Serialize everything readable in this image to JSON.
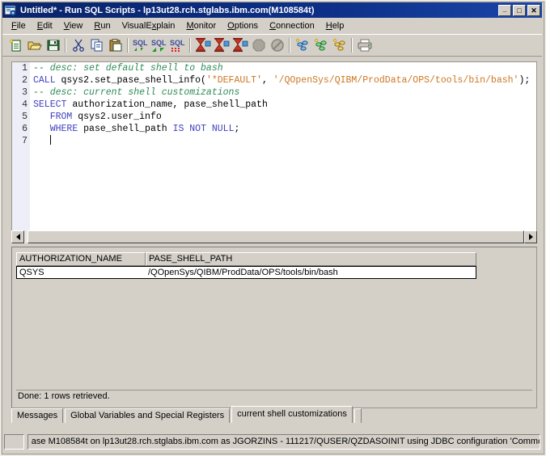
{
  "window": {
    "title": "Untitled* - Run SQL Scripts - lp13ut28.rch.stglabs.ibm.com(M108584t)",
    "app_icon": "sql-scripts-icon",
    "minimize_glyph": "_",
    "maximize_glyph": "□",
    "close_glyph": "✕",
    "titlebar_color": "#0a246a",
    "face_color": "#d4d0c8"
  },
  "menu": {
    "items": [
      {
        "label": "File",
        "mnemonic": "F"
      },
      {
        "label": "Edit",
        "mnemonic": "E"
      },
      {
        "label": "View",
        "mnemonic": "V"
      },
      {
        "label": "Run",
        "mnemonic": "R"
      },
      {
        "label": "VisualExplain",
        "mnemonic": "x"
      },
      {
        "label": "Monitor",
        "mnemonic": "M"
      },
      {
        "label": "Options",
        "mnemonic": "O"
      },
      {
        "label": "Connection",
        "mnemonic": "C"
      },
      {
        "label": "Help",
        "mnemonic": "H"
      }
    ]
  },
  "toolbar": {
    "buttons": [
      {
        "name": "new-icon",
        "tooltip": "New"
      },
      {
        "name": "open-icon",
        "tooltip": "Open"
      },
      {
        "name": "save-icon",
        "tooltip": "Save"
      },
      {
        "name": "separator",
        "tooltip": ""
      },
      {
        "name": "cut-icon",
        "tooltip": "Cut"
      },
      {
        "name": "copy-icon",
        "tooltip": "Copy"
      },
      {
        "name": "paste-icon",
        "tooltip": "Paste"
      },
      {
        "name": "separator",
        "tooltip": ""
      },
      {
        "name": "run-selected-sql-icon",
        "tooltip": "Run Selected"
      },
      {
        "name": "run-from-selected-sql-icon",
        "tooltip": "Run From Selected"
      },
      {
        "name": "run-all-sql-icon",
        "tooltip": "Run All"
      },
      {
        "name": "separator",
        "tooltip": ""
      },
      {
        "name": "stop-on-error-icon",
        "tooltip": "Stop On Error"
      },
      {
        "name": "run-and-stop-icon",
        "tooltip": "Run and Stop"
      },
      {
        "name": "continue-icon",
        "tooltip": "Continue"
      },
      {
        "name": "stop-icon",
        "tooltip": "Stop"
      },
      {
        "name": "cancel-icon",
        "tooltip": "Cancel Request"
      },
      {
        "name": "separator",
        "tooltip": ""
      },
      {
        "name": "visual-explain-icon",
        "tooltip": "Visual Explain"
      },
      {
        "name": "explain-only-icon",
        "tooltip": "Explain Only"
      },
      {
        "name": "run-and-explain-icon",
        "tooltip": "Run and Explain"
      },
      {
        "name": "separator",
        "tooltip": ""
      },
      {
        "name": "print-icon",
        "tooltip": "Print"
      }
    ]
  },
  "editor": {
    "line_numbers": [
      "1",
      "2",
      "3",
      "4",
      "5",
      "6",
      "7"
    ],
    "lines": [
      {
        "n": "1",
        "tokens": [
          {
            "t": "-- desc: set default shell to bash",
            "k": "comment"
          }
        ]
      },
      {
        "n": "2",
        "tokens": [
          {
            "t": "CALL",
            "k": "kw"
          },
          {
            "t": " qsys2.set_pase_shell_info(",
            "k": "plain"
          },
          {
            "t": "'*DEFAULT'",
            "k": "str"
          },
          {
            "t": ", ",
            "k": "plain"
          },
          {
            "t": "'/QOpenSys/QIBM/ProdData/OPS/tools/bin/bash'",
            "k": "str"
          },
          {
            "t": ");",
            "k": "plain"
          }
        ]
      },
      {
        "n": "3",
        "tokens": [
          {
            "t": "-- desc: current shell customizations",
            "k": "comment"
          }
        ]
      },
      {
        "n": "4",
        "tokens": [
          {
            "t": "SELECT",
            "k": "kw"
          },
          {
            "t": " authorization_name, pase_shell_path",
            "k": "plain"
          }
        ]
      },
      {
        "n": "5",
        "tokens": [
          {
            "t": "   ",
            "k": "plain"
          },
          {
            "t": "FROM",
            "k": "kw"
          },
          {
            "t": " qsys2.user_info",
            "k": "plain"
          }
        ]
      },
      {
        "n": "6",
        "tokens": [
          {
            "t": "   ",
            "k": "plain"
          },
          {
            "t": "WHERE",
            "k": "kw"
          },
          {
            "t": " pase_shell_path ",
            "k": "plain"
          },
          {
            "t": "IS NOT NULL",
            "k": "kw"
          },
          {
            "t": ";",
            "k": "plain"
          }
        ]
      },
      {
        "n": "7",
        "tokens": [
          {
            "t": "   ",
            "k": "plain"
          }
        ]
      }
    ],
    "colors": {
      "comment": "#2e8b57",
      "keyword": "#4040c0",
      "string": "#cc7722",
      "gutter_bg": "#eeeef8"
    }
  },
  "results": {
    "columns": [
      "AUTHORIZATION_NAME",
      "PASE_SHELL_PATH"
    ],
    "rows": [
      [
        "QSYS",
        "/QOpenSys/QIBM/ProdData/OPS/tools/bin/bash"
      ]
    ],
    "status": "Done: 1 rows retrieved."
  },
  "tabs": [
    {
      "label": "Messages",
      "active": false
    },
    {
      "label": "Global Variables and Special Registers",
      "active": false
    },
    {
      "label": "current shell customizations",
      "active": true
    }
  ],
  "statusbar": {
    "left_cell": "",
    "message": "ase M108584t on lp13ut28.rch.stglabs.ibm.com as JGORZINS - 111217/QUSER/QZDASOINIT using JDBC configuration 'Common BE'."
  }
}
